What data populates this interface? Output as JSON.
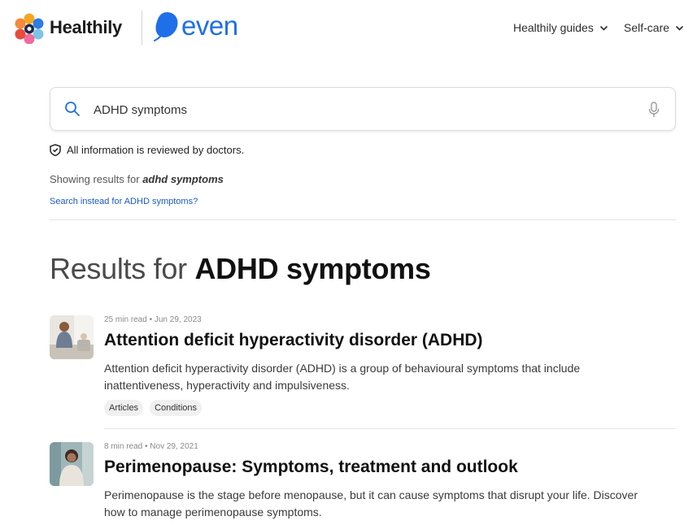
{
  "header": {
    "brand_name": "Healthily",
    "partner_name": "even",
    "nav": [
      {
        "label": "Healthily guides"
      },
      {
        "label": "Self-care"
      }
    ]
  },
  "search": {
    "value": "ADHD symptoms",
    "icon": "search-icon",
    "voice_icon": "microphone-icon"
  },
  "notice": {
    "reviewed_text": "All information is reviewed by doctors."
  },
  "spelling": {
    "showing_prefix": "Showing results for",
    "showing_query": "adhd symptoms",
    "instead_link": "Search instead for ADHD symptoms?"
  },
  "results": {
    "heading_prefix": "Results for",
    "heading_query": "ADHD symptoms",
    "items": [
      {
        "meta": "25 min read • Jun 29, 2023",
        "title": "Attention deficit hyperactivity disorder (ADHD)",
        "description": "Attention deficit hyperactivity disorder (ADHD) is a group of behavioural symptoms that include inattentiveness, hyperactivity and impulsiveness.",
        "tags": [
          "Articles",
          "Conditions"
        ]
      },
      {
        "meta": "8 min read • Nov 29, 2021",
        "title": "Perimenopause: Symptoms, treatment and outlook",
        "description": "Perimenopause is the stage before menopause, but it can cause symptoms that disrupt your life. Discover how to manage perimenopause symptoms."
      }
    ]
  },
  "colors": {
    "accent_blue": "#1e6fe8",
    "link_blue": "#1a5bc4"
  }
}
